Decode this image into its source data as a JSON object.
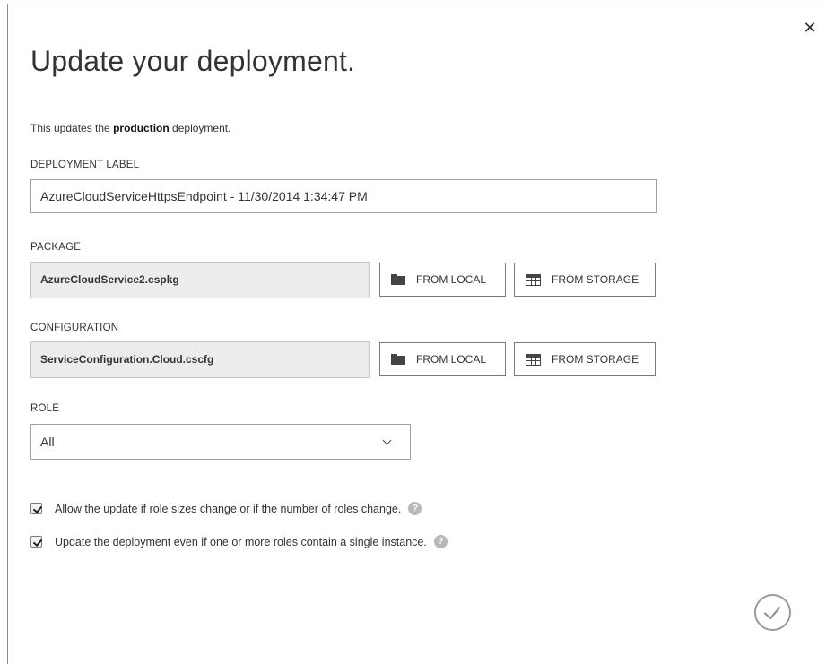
{
  "dialog": {
    "close_glyph": "✕",
    "title": "Update your deployment.",
    "description": {
      "prefix": "This updates the ",
      "emphasis": "production",
      "suffix": " deployment."
    }
  },
  "deployment_label": {
    "label": "DEPLOYMENT LABEL",
    "value": "AzureCloudServiceHttpsEndpoint - 11/30/2014 1:34:47 PM"
  },
  "package": {
    "label": "PACKAGE",
    "file": "AzureCloudService2.cspkg",
    "from_local": "FROM LOCAL",
    "from_storage": "FROM STORAGE"
  },
  "configuration": {
    "label": "CONFIGURATION",
    "file": "ServiceConfiguration.Cloud.cscfg",
    "from_local": "FROM LOCAL",
    "from_storage": "FROM STORAGE"
  },
  "role": {
    "label": "ROLE",
    "selected": "All"
  },
  "options": [
    {
      "label": "Allow the update if role sizes change or if the number of roles change.",
      "checked": true
    },
    {
      "label": "Update the deployment even if one or more roles contain a single instance.",
      "checked": true
    }
  ],
  "icons": {
    "close": "close-icon",
    "folder": "folder-icon",
    "storage": "table-icon",
    "help": "help-icon",
    "confirm": "checkmark-icon"
  }
}
